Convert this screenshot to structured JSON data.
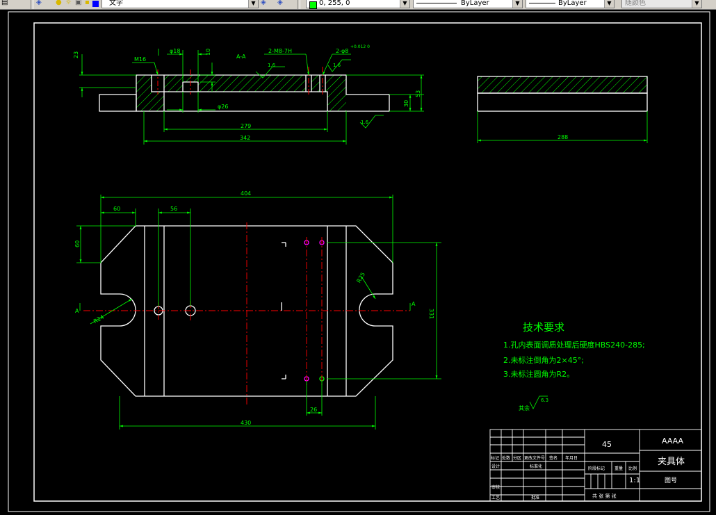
{
  "toolbar": {
    "layer_name": "文字",
    "color_value": "0, 255, 0",
    "linetype": "ByLayer",
    "lineweight": "ByLayer",
    "plotstyle": "随颜色"
  },
  "front_view": {
    "dim_23": "23",
    "dim_m16": "M16",
    "dim_phi18": "φ18",
    "dim_10": "10",
    "section_mark": "A-A",
    "dim_holes": "2-M8-7H",
    "dim_pins": "2-φ8",
    "dim_tol": "+0.012\n0",
    "rough_1": "1.6",
    "rough_2": "1.6",
    "rough_3": "1.6",
    "dim_phi26": "φ26",
    "dim_30": "30",
    "dim_53": "53",
    "dim_279": "279",
    "dim_342": "342"
  },
  "side_view": {
    "dim_288": "288"
  },
  "top_view": {
    "dim_404": "404",
    "dim_60": "60",
    "dim_56": "56",
    "dim_60v": "60",
    "dim_r24": "R24",
    "dim_r25": "R25",
    "dim_331": "331",
    "dim_26": "26",
    "dim_430": "430",
    "sec_a_left": "A",
    "sec_a_right": "A"
  },
  "tech_req": {
    "title": "技术要求",
    "line1": "1.孔内表面调质处理后硬度HBS240-285;",
    "line2": "2.未标注倒角为2×45°;",
    "line3": "3.未标注圆角为R2。",
    "other_rough_label": "其余",
    "other_rough_value": "6.3"
  },
  "title_block": {
    "material": "45",
    "company": "AAAA",
    "part_name": "夹具体",
    "scale": "1:1",
    "drawing_no": "图号",
    "stage_label": "阶段标记",
    "weight_label": "重量",
    "scale_label": "比例",
    "sheet_label": "共 张 第 张",
    "rev_labels": [
      "标记",
      "处数",
      "分区",
      "更改文件号",
      "签名",
      "年月日"
    ],
    "design": "设计",
    "standard": "标准化",
    "review": "审核",
    "process": "工艺",
    "approve": "批准"
  },
  "colors": {
    "background": "#000000",
    "outline": "#ffffff",
    "dimension": "#00ff00",
    "centerline": "#ff0000",
    "hatch": "#00ff00",
    "text": "#00ff00",
    "hole_marker": "#ff00ff"
  }
}
